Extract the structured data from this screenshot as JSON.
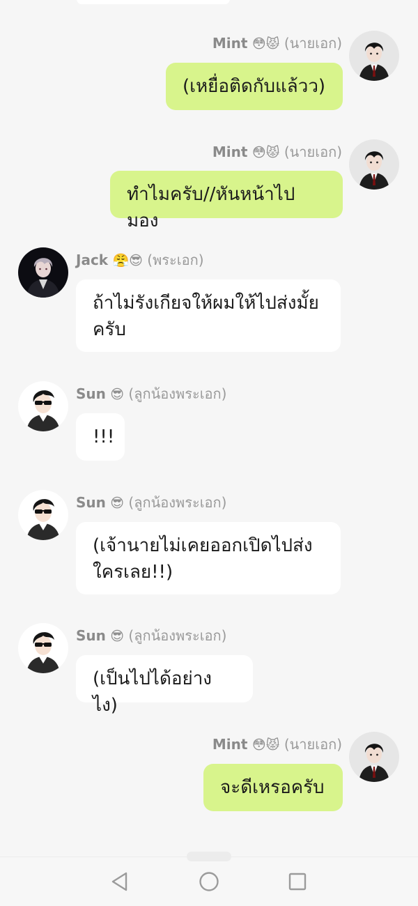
{
  "status_bar": {
    "left_text": "",
    "right_text": ""
  },
  "messages": [
    {
      "side": "right",
      "name": "Mint",
      "emoji": "😳😾",
      "role": "(นายเอก)",
      "text": "(เหยื่อติดกับแล้วว)",
      "avatar": "mint"
    },
    {
      "side": "right",
      "name": "Mint",
      "emoji": "😳😾",
      "role": "(นายเอก)",
      "text": "ทำไมครับ//หันหน้าไปมอง",
      "avatar": "mint"
    },
    {
      "side": "left",
      "name": "Jack",
      "emoji": "😤😎",
      "role": "(พระเอก)",
      "text": "ถ้าไม่รังเกียจให้ผมให้ไปส่งมั้ยครับ",
      "avatar": "jack"
    },
    {
      "side": "left",
      "name": "Sun",
      "emoji": "😎",
      "role": "(ลูกน้องพระเอก)",
      "text": "!!!",
      "avatar": "sun"
    },
    {
      "side": "left",
      "name": "Sun",
      "emoji": "😎",
      "role": "(ลูกน้องพระเอก)",
      "text": "(เจ้านายไม่เคยออกเปิดไปส่งใครเลย!!)",
      "avatar": "sun"
    },
    {
      "side": "left",
      "name": "Sun",
      "emoji": "😎",
      "role": "(ลูกน้องพระเอก)",
      "text": "(เป็นไปได้อย่างไง)",
      "avatar": "sun"
    },
    {
      "side": "right",
      "name": "Mint",
      "emoji": "😳😾",
      "role": "(นายเอก)",
      "text": "จะดีเหรอครับ",
      "avatar": "mint"
    }
  ],
  "nav": {
    "back_icon": "triangle-back-icon",
    "home_icon": "circle-home-icon",
    "recents_icon": "square-recents-icon"
  },
  "colors": {
    "mine_bubble": "#d8f48c",
    "theirs_bubble": "#ffffff",
    "background": "#f6f6f6"
  }
}
